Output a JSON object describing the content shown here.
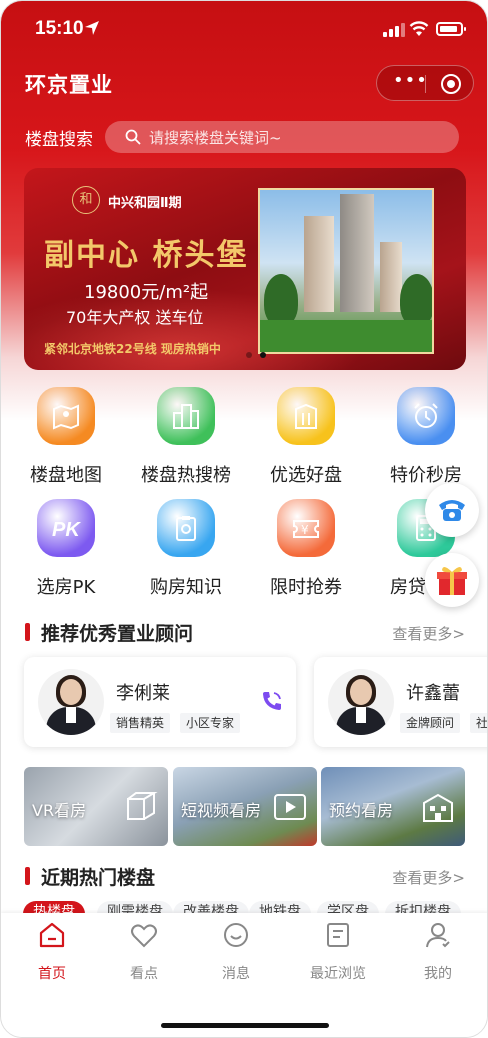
{
  "status_bar": {
    "time": "15:10"
  },
  "header": {
    "app_title": "环京置业",
    "capsule_more_icon": "more-icon",
    "capsule_target_icon": "target-icon"
  },
  "search": {
    "label": "楼盘搜索",
    "placeholder": "请搜索楼盘关键词~"
  },
  "banner": {
    "logo_mark": "和",
    "logo_text": "中兴和园Ⅱ期",
    "slogan": "副中心 桥头堡",
    "price": "19800元/m²起",
    "rights": "70年大产权 送车位",
    "footer": "紧邻北京地铁22号线 现房热销中",
    "active_dot": 1
  },
  "menu": [
    {
      "label": "楼盘地图",
      "icon": "map-icon",
      "color": "#f58a22"
    },
    {
      "label": "楼盘热搜榜",
      "icon": "buildings-icon",
      "color": "#3fc05a"
    },
    {
      "label": "优选好盘",
      "icon": "building-icon",
      "color": "#f7c21c"
    },
    {
      "label": "特价秒房",
      "icon": "clock-icon",
      "color": "#4a8ff0"
    },
    {
      "label": "选房PK",
      "icon": "pk-icon",
      "color": "#7d5af0"
    },
    {
      "label": "购房知识",
      "icon": "clipboard-icon",
      "color": "#38a6f0"
    },
    {
      "label": "限时抢券",
      "icon": "coupon-icon",
      "color": "#f46a3a"
    },
    {
      "label": "房贷计算",
      "icon": "calculator-icon",
      "color": "#2ec99a"
    }
  ],
  "consultants_section": {
    "title": "推荐优秀置业顾问",
    "more": "查看更多>"
  },
  "consultants": [
    {
      "name": "李俐莱",
      "tags": [
        "销售精英",
        "小区专家"
      ]
    },
    {
      "name": "许鑫蕾",
      "tags": [
        "金牌顾问",
        "社"
      ]
    }
  ],
  "features": [
    {
      "label": "VR看房",
      "icon": "vr-cube-icon"
    },
    {
      "label": "短视频看房",
      "icon": "video-play-icon"
    },
    {
      "label": "预约看房",
      "icon": "building-calendar-icon"
    }
  ],
  "hot_section": {
    "title": "近期热门楼盘",
    "more": "查看更多>"
  },
  "chips": [
    "热楼盘",
    "刚需楼盘",
    "改善楼盘",
    "地铁盘",
    "学区盘",
    "拆扣楼盘"
  ],
  "tabbar": [
    {
      "label": "首页",
      "icon": "home-icon",
      "active": true
    },
    {
      "label": "看点",
      "icon": "heart-icon",
      "active": false
    },
    {
      "label": "消息",
      "icon": "message-smile-icon",
      "active": false
    },
    {
      "label": "最近浏览",
      "icon": "history-doc-icon",
      "active": false
    },
    {
      "label": "我的",
      "icon": "user-icon",
      "active": false
    }
  ],
  "colors": {
    "brand_red": "#d3151b",
    "banner_gold": "#f3c86a"
  }
}
